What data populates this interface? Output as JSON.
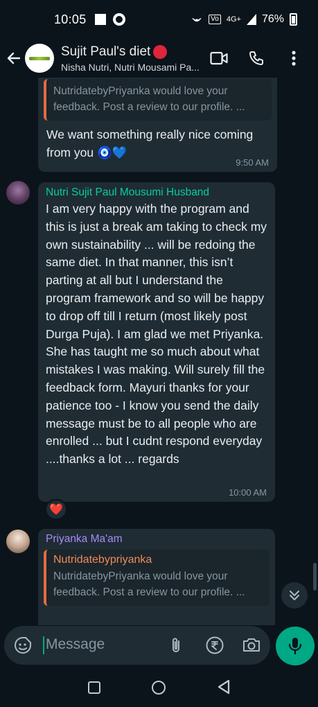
{
  "status_bar": {
    "time": "10:05",
    "battery": "76%",
    "network_label": "4G+"
  },
  "header": {
    "title": "Sujit Paul's diet",
    "subtitle": "Nisha Nutri, Nutri Mousami Pa..."
  },
  "messages": [
    {
      "quote_text": "NutridatebyPriyanka would love your feedback. Post a review to our profile. ...",
      "text": "We want something really nice coming from you 🧿💙",
      "time": "9:50 AM"
    },
    {
      "sender": "Nutri Sujit Paul Mousumi Husband",
      "text": "I am very happy with the program and this is just a break am taking to check my own sustainability ... will be redoing the same diet. In that manner, this isn’t parting at all but I understand the program framework and so will be happy to drop off till I return (most likely post Durga Puja). I am glad we met Priyanka. She has taught me so much about what mistakes I was making. Will surely fill the feedback form. Mayuri thanks for your patience too - I know you send the daily message must be to all people who are enrolled ... but I cudnt respond everyday ....thanks a lot ... regards",
      "time": "10:00 AM",
      "reaction": "❤️"
    },
    {
      "sender": "Priyanka Ma'am",
      "quote_author": "Nutridatebypriyanka",
      "quote_text": "NutridatebyPriyanka would love your feedback. Post a review to our profile. ..."
    }
  ],
  "composer": {
    "placeholder": "Message"
  },
  "colors": {
    "accent": "#00a884",
    "bubble": "#1f2c34",
    "background": "#0b141a",
    "sender_green": "#06cf9c",
    "sender_purple": "#a78bfa",
    "quote_orange": "#e26b3f"
  },
  "icons": [
    "back-arrow-icon",
    "video-call-icon",
    "phone-icon",
    "more-vert-icon",
    "emoji-sticker-icon",
    "attach-icon",
    "rupee-payment-icon",
    "camera-icon",
    "mic-icon",
    "scroll-down-icon"
  ]
}
